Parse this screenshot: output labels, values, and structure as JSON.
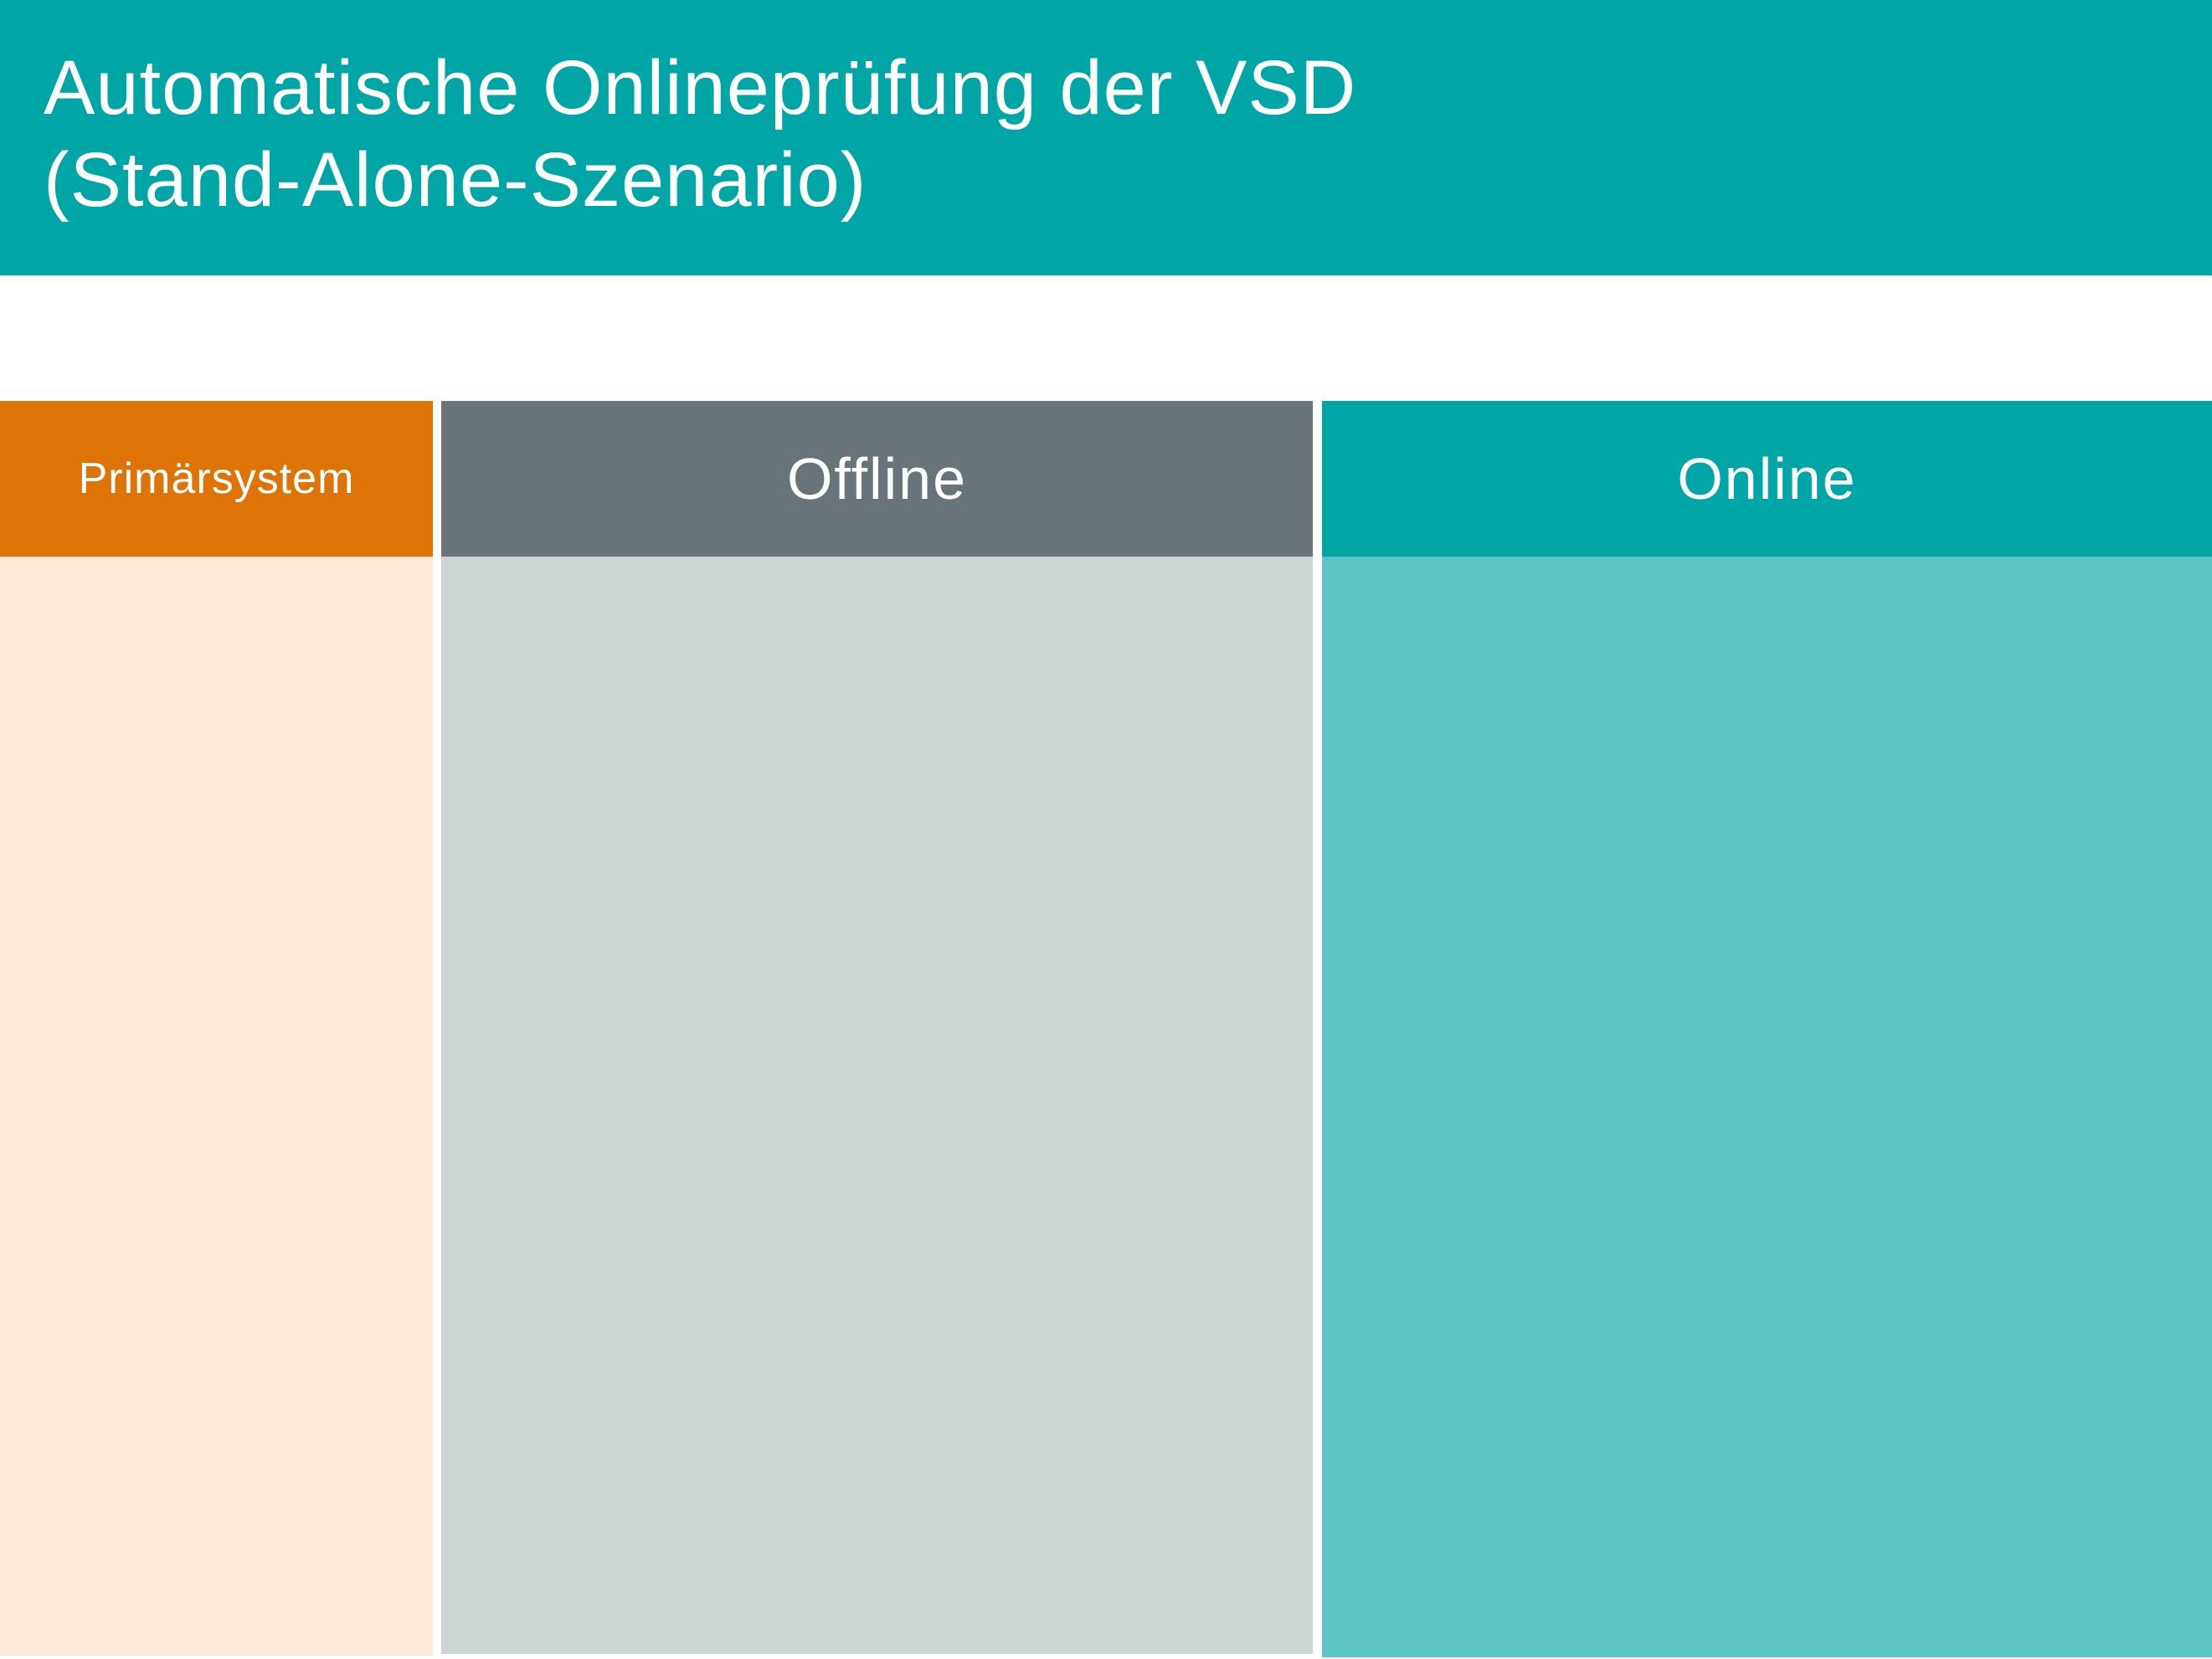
{
  "title": {
    "line1": "Automatische Onlineprüfung der VSD",
    "line2": "(Stand-Alone-Szenario)"
  },
  "columns": [
    {
      "label": "Primärsystem",
      "header_color": "#de7306",
      "body_color": "#fdebd9"
    },
    {
      "label": "Offline",
      "header_color": "#687479",
      "body_color": "#cdd4d4"
    },
    {
      "label": "Online",
      "header_color": "#00a6a5",
      "body_color": "#5dc6c3"
    }
  ],
  "colors": {
    "title_bar": "#00a6a5",
    "text": "#ffffff",
    "background": "#ffffff"
  }
}
